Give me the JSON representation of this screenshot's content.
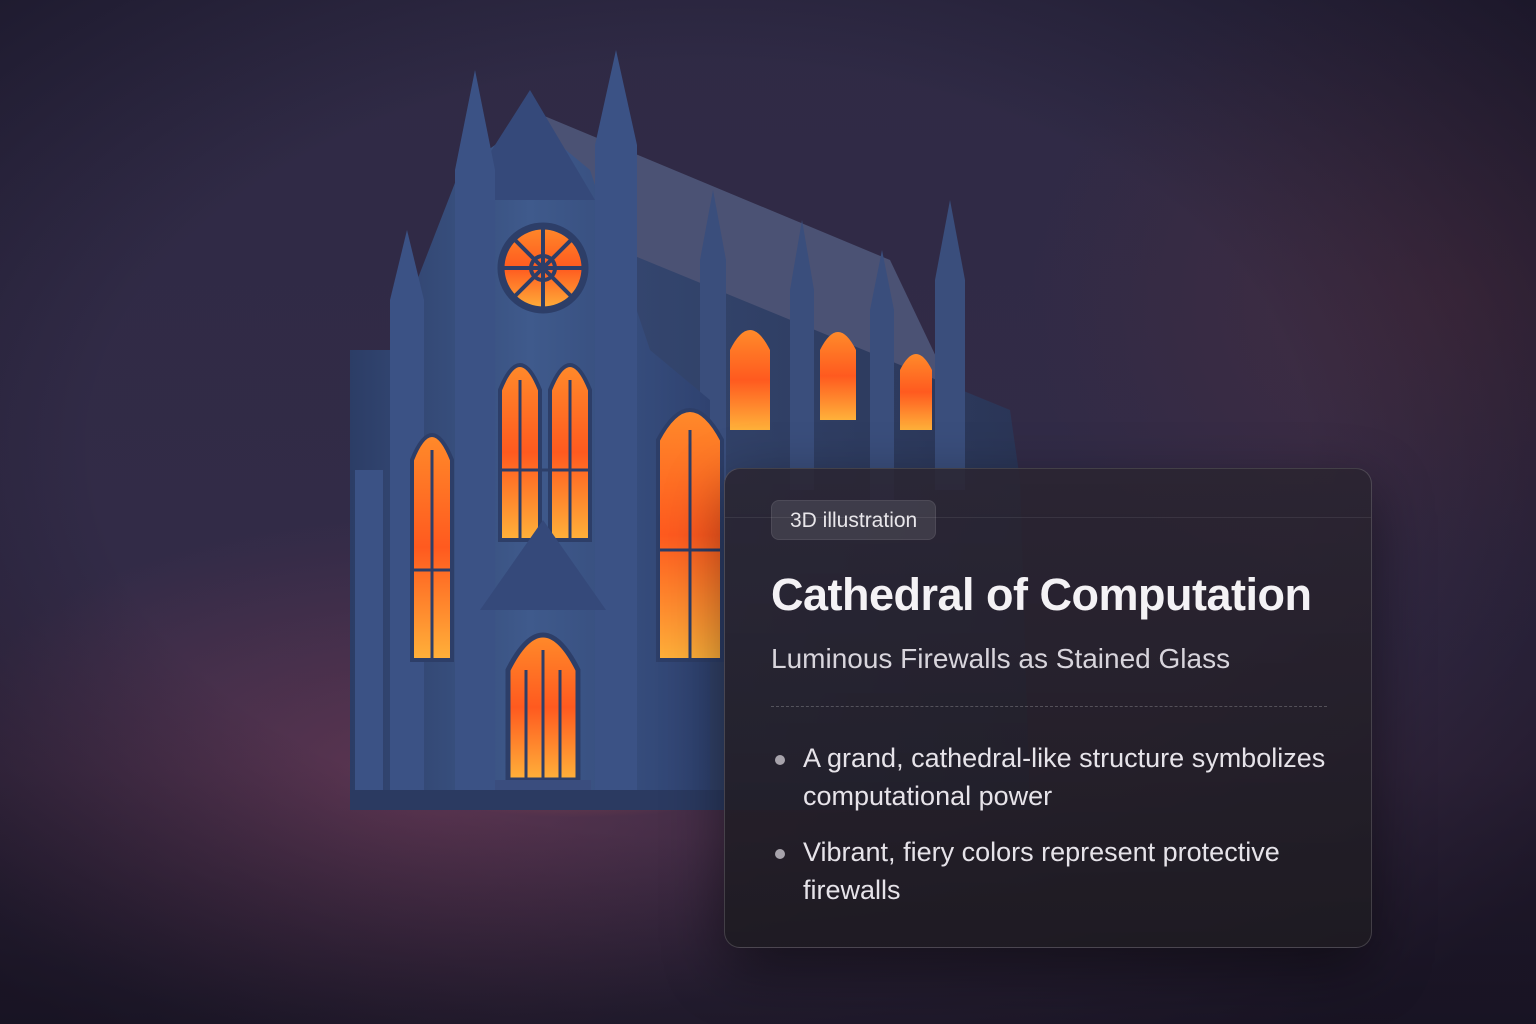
{
  "illustration": {
    "name": "gothic cathedral with glowing stained-glass windows",
    "colors": {
      "stone": "#3d5583",
      "stone_dark": "#2a3a60",
      "roof": "#4a5270",
      "fire": "#ff5a1f",
      "fire_light": "#ffb13a"
    }
  },
  "card": {
    "badge": "3D illustration",
    "title": "Cathedral of Computation",
    "subtitle": "Luminous Firewalls as Stained Glass",
    "bullets": [
      "A grand, cathedral-like structure symbolizes computational power",
      "Vibrant, fiery colors represent protective firewalls"
    ]
  }
}
